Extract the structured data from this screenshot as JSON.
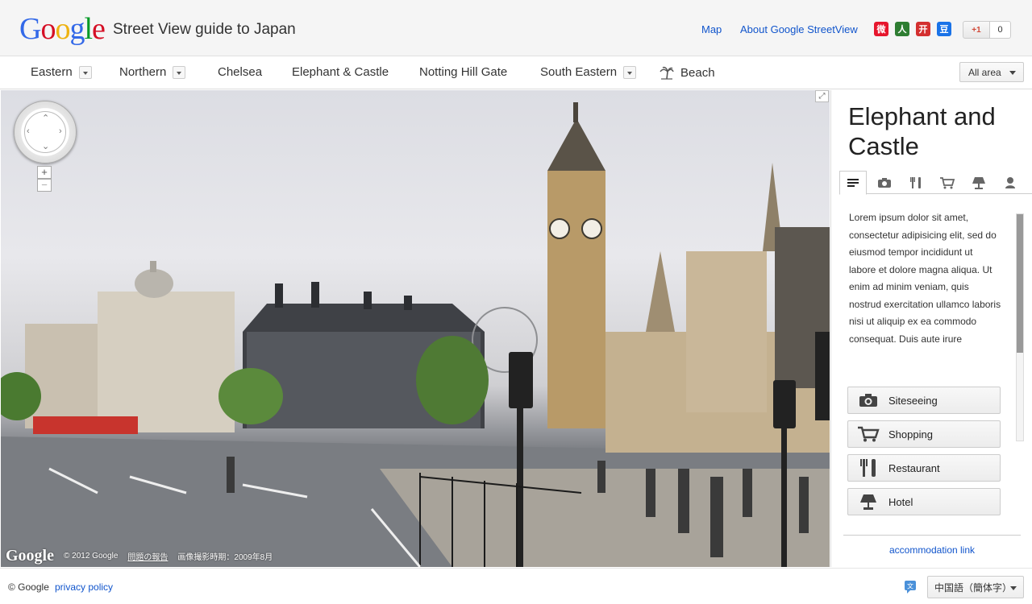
{
  "header": {
    "logo_letters": [
      {
        "ch": "G",
        "color": "#3369e8"
      },
      {
        "ch": "o",
        "color": "#d50f25"
      },
      {
        "ch": "o",
        "color": "#eeb211"
      },
      {
        "ch": "g",
        "color": "#3369e8"
      },
      {
        "ch": "l",
        "color": "#009925"
      },
      {
        "ch": "e",
        "color": "#d50f25"
      }
    ],
    "site_title": "Street View guide to Japan",
    "links": {
      "map": "Map",
      "about": "About Google StreetView"
    },
    "share_icons": [
      {
        "name": "weibo-icon",
        "glyph": "微",
        "color": "#e6162d"
      },
      {
        "name": "renren-icon",
        "glyph": "人",
        "color": "#2e7d32"
      },
      {
        "name": "kaixin-icon",
        "glyph": "开",
        "color": "#d32f2f"
      },
      {
        "name": "douban-icon",
        "glyph": "豆",
        "color": "#1a73e8"
      }
    ],
    "plusone": {
      "label": "+1",
      "count": "0"
    }
  },
  "nav": {
    "items": [
      {
        "label": "Eastern",
        "dropdown": true
      },
      {
        "label": "Northern",
        "dropdown": true
      },
      {
        "label": "Chelsea",
        "dropdown": false
      },
      {
        "label": "Elephant & Castle",
        "dropdown": false
      },
      {
        "label": "Notting Hill Gate",
        "dropdown": false
      },
      {
        "label": "South Eastern",
        "dropdown": true
      },
      {
        "label": "Beach",
        "dropdown": false,
        "icon": "palm-tree-icon"
      }
    ],
    "all_area": "All area"
  },
  "streetview": {
    "zoom_in": "+",
    "zoom_out": "−",
    "logo": "Google",
    "copyright": "© 2012 Google",
    "report": "問題の報告",
    "capture_date": "画像撮影時期：2009年8月"
  },
  "sidebar": {
    "title": "Elephant and Castle",
    "tabs": [
      "info-icon",
      "camera-icon",
      "restaurant-icon",
      "cart-icon",
      "hotel-icon",
      "person-icon"
    ],
    "description": "Lorem ipsum dolor sit amet, consectetur adipisicing elit, sed do eiusmod tempor incididunt ut labore et dolore magna aliqua. Ut enim ad minim veniam, quis nostrud exercitation ullamco laboris nisi ut aliquip ex ea commodo consequat. Duis aute irure",
    "categories": [
      {
        "label": "Siteseeing",
        "icon": "camera-icon"
      },
      {
        "label": "Shopping",
        "icon": "cart-icon"
      },
      {
        "label": "Restaurant",
        "icon": "restaurant-icon"
      },
      {
        "label": "Hotel",
        "icon": "hotel-icon"
      }
    ],
    "accommodation_link": "accommodation link"
  },
  "footer": {
    "copyright": "© Google",
    "privacy": "privacy policy",
    "language": "中国語（簡体字）"
  }
}
